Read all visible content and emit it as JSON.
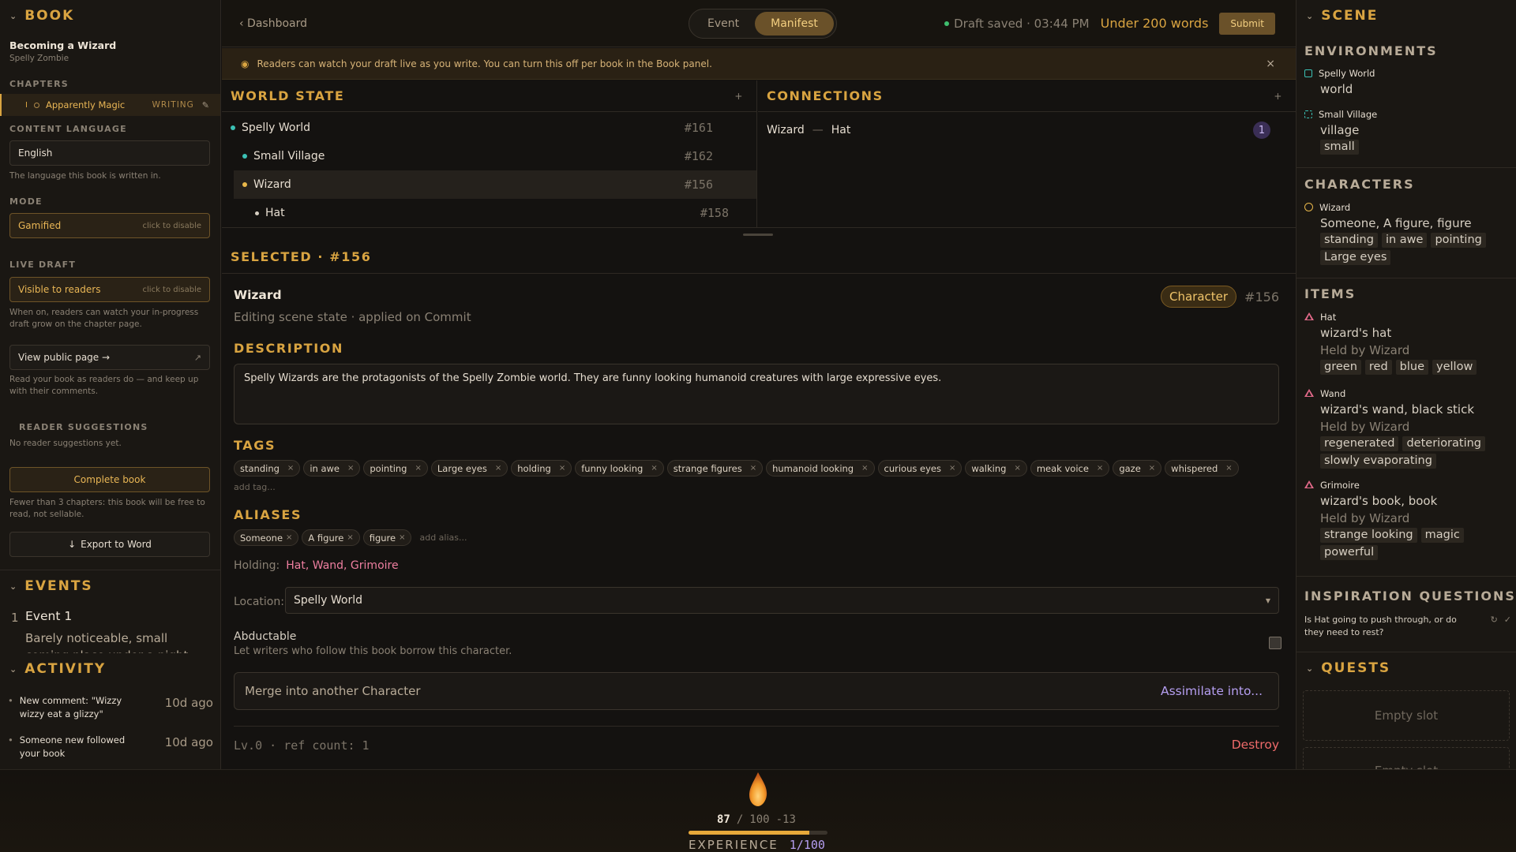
{
  "book": {
    "section": "BOOK",
    "title": "Becoming a Wizard",
    "author": "Spelly Zombie",
    "chapters_label": "CHAPTERS",
    "chapter": {
      "marker": "I",
      "name": "Apparently Magic",
      "status": "WRITING"
    },
    "content_language_label": "CONTENT LANGUAGE",
    "language": "English",
    "language_help": "The language this book is written in.",
    "mode_label": "MODE",
    "mode_value": "Gamified",
    "mode_hint": "click to disable",
    "live_draft_label": "LIVE DRAFT",
    "live_draft_value": "Visible to readers",
    "live_draft_hint": "click to disable",
    "live_draft_help": "When on, readers can watch your in-progress draft grow on the chapter page.",
    "view_public": "View public page →",
    "view_public_help": "Read your book as readers do — and keep up with their comments.",
    "reader_suggestions_label": "READER SUGGESTIONS",
    "reader_suggestions_empty": "No reader suggestions yet.",
    "complete_book": "Complete book",
    "complete_help": "Fewer than 3 chapters: this book will be free to read, not sellable.",
    "export": "Export to Word"
  },
  "events": {
    "section": "EVENTS",
    "items": [
      {
        "num": "1",
        "title": "Event 1",
        "desc": "Barely noticeable, small coming place under a night sky"
      }
    ]
  },
  "activity": {
    "section": "ACTIVITY",
    "items": [
      {
        "text": "New comment: \"Wizzy wizzy eat a glizzy\"",
        "time": "10d ago"
      },
      {
        "text": "Someone new followed your book",
        "time": "10d ago"
      }
    ]
  },
  "header": {
    "back": "‹ Dashboard",
    "tab_event": "Event",
    "tab_manifest": "Manifest",
    "draft_status": "Draft saved · 03:44 PM",
    "word_limit": "Under 200 words",
    "submit": "Submit"
  },
  "banner": {
    "text": "Readers can watch your draft live as you write. You can turn this off per book in the Book panel.",
    "close": "×"
  },
  "world_state": {
    "title": "WORLD STATE",
    "add": "+",
    "rows": [
      {
        "name": "Spelly World",
        "id": "#161",
        "color": "#3bc1b5"
      },
      {
        "name": "Small Village",
        "id": "#162",
        "color": "#3bc1b5"
      },
      {
        "name": "Wizard",
        "id": "#156",
        "color": "#e8b74a"
      },
      {
        "name": "Hat",
        "id": "#158",
        "color": "#d7cfc2"
      }
    ]
  },
  "connections": {
    "title": "CONNECTIONS",
    "add": "+",
    "from": "Wizard",
    "sep": "—",
    "to": "Hat",
    "count": "1"
  },
  "selected": {
    "title": "SELECTED · #156",
    "name": "Wizard",
    "subtitle": "Editing scene state · applied on Commit",
    "type": "Character",
    "id": "#156",
    "description_label": "DESCRIPTION",
    "description": "Spelly Wizards are the protagonists of the Spelly Zombie world. They are funny looking humanoid creatures with large expressive eyes.",
    "tags_label": "TAGS",
    "tags": [
      "standing",
      "in awe",
      "pointing",
      "Large eyes",
      "holding",
      "funny looking",
      "strange figures",
      "humanoid looking",
      "curious eyes",
      "walking",
      "meak voice",
      "gaze",
      "whispered"
    ],
    "add_tag": "add tag...",
    "aliases_label": "ALIASES",
    "aliases": [
      "Someone",
      "A figure",
      "figure"
    ],
    "add_alias": "add alias...",
    "holding_label": "Holding:",
    "holding": "Hat, Wand, Grimoire",
    "location_label": "Location:",
    "location": "Spelly World",
    "abductable_label": "Abductable",
    "abductable_help": "Let writers who follow this book borrow this character.",
    "merge_label": "Merge into another Character",
    "assimilate": "Assimilate into...",
    "level": "Lv.0 · ref count: 1",
    "destroy": "Destroy"
  },
  "scene": {
    "section": "SCENE",
    "environments_label": "ENVIRONMENTS",
    "environments": [
      {
        "name": "Spelly World",
        "sub": "world",
        "chips": []
      },
      {
        "name": "Small Village",
        "sub": "village",
        "chips": [
          "small"
        ]
      }
    ],
    "characters_label": "CHARACTERS",
    "characters": [
      {
        "name": "Wizard",
        "sub": "Someone, A figure, figure",
        "chips": [
          "standing",
          "in awe",
          "pointing",
          "Large eyes"
        ]
      }
    ],
    "items_label": "ITEMS",
    "items": [
      {
        "name": "Hat",
        "sub": "wizard's hat",
        "held": "Held by Wizard",
        "chips": [
          "green",
          "red",
          "blue",
          "yellow"
        ]
      },
      {
        "name": "Wand",
        "sub": "wizard's wand, black stick",
        "held": "Held by Wizard",
        "chips": [
          "regenerated",
          "deteriorating",
          "slowly evaporating"
        ]
      },
      {
        "name": "Grimoire",
        "sub": "wizard's book, book",
        "held": "Held by Wizard",
        "chips": [
          "strange looking",
          "magic",
          "powerful"
        ]
      }
    ],
    "inspiration_label": "INSPIRATION QUESTIONS",
    "inspiration_q": "Is Hat going to push through, or do they need to rest?",
    "quests_label": "QUESTS",
    "quest_slot": "Empty slot",
    "quest_slot2": "Empty slot"
  },
  "footer": {
    "current": "87",
    "slash": "/",
    "max": "100",
    "delta": "-13",
    "progress": 0.87,
    "experience_label": "EXPERIENCE",
    "experience": "1/100"
  }
}
